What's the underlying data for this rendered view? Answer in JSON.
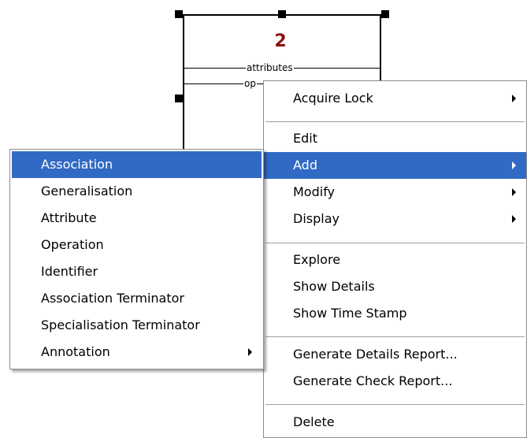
{
  "diagram": {
    "class_number": "2",
    "compartments": {
      "attributes": "attributes",
      "operations": "op"
    }
  },
  "context_menu": {
    "items": {
      "acquire_lock": "Acquire Lock",
      "edit": "Edit",
      "add": "Add",
      "modify": "Modify",
      "display": "Display",
      "explore": "Explore",
      "show_details": "Show Details",
      "show_time_stamp": "Show Time Stamp",
      "generate_details_report": "Generate Details Report...",
      "generate_check_report": "Generate Check Report...",
      "delete": "Delete"
    },
    "highlighted": "Add"
  },
  "add_submenu": {
    "items": {
      "association": "Association",
      "generalisation": "Generalisation",
      "attribute": "Attribute",
      "operation": "Operation",
      "identifier": "Identifier",
      "association_terminator": "Association Terminator",
      "specialisation_terminator": "Specialisation Terminator",
      "annotation": "Annotation"
    },
    "highlighted": "Association"
  },
  "colors": {
    "selection": "#316ac5",
    "class_number": "#8b1010"
  },
  "icons": {
    "submenu_arrow": "submenu-arrow-icon"
  }
}
